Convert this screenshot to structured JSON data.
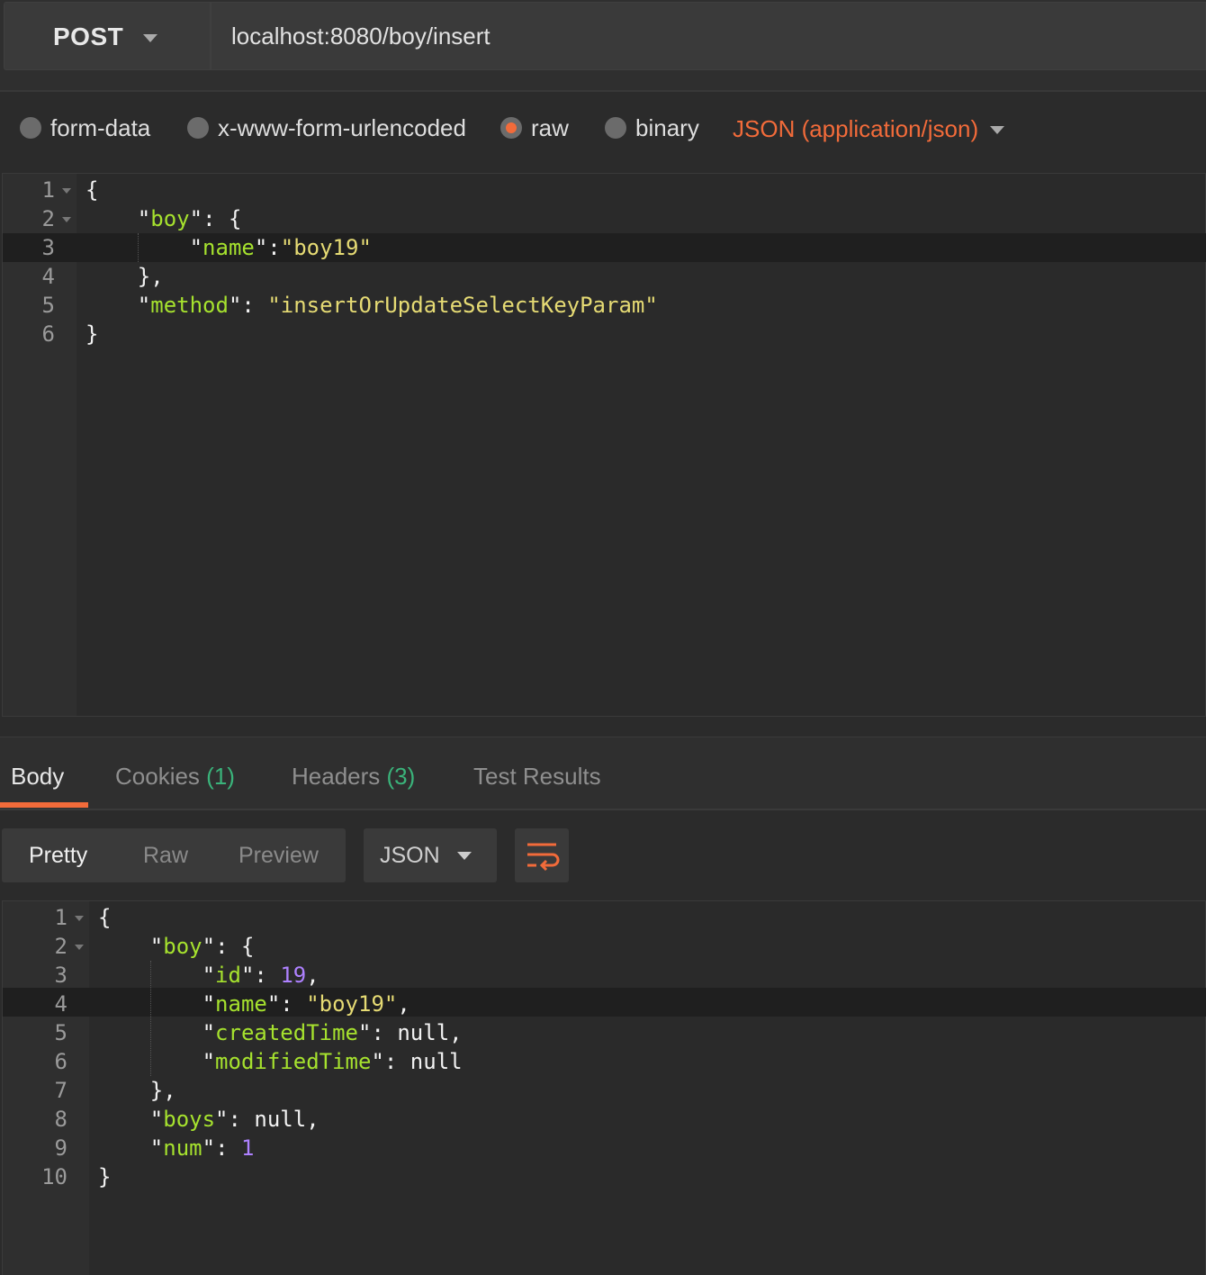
{
  "request": {
    "method": "POST",
    "url": "localhost:8080/boy/insert"
  },
  "body_modes": {
    "options": [
      "form-data",
      "x-www-form-urlencoded",
      "raw",
      "binary"
    ],
    "selected": "raw",
    "content_type": "JSON (application/json)"
  },
  "request_editor": {
    "line_numbers": [
      "1",
      "2",
      "3",
      "4",
      "5",
      "6"
    ],
    "lines": [
      "{",
      "    \"boy\": {",
      "        \"name\":\"boy19\"",
      "    },",
      "    \"method\": \"insertOrUpdateSelectKeyParam\"",
      "}"
    ]
  },
  "response_tabs": {
    "body": "Body",
    "cookies": "Cookies",
    "cookies_count": "(1)",
    "headers": "Headers",
    "headers_count": "(3)",
    "tests": "Test Results"
  },
  "view_modes": {
    "pretty": "Pretty",
    "raw": "Raw",
    "preview": "Preview",
    "format": "JSON"
  },
  "response_editor": {
    "line_numbers": [
      "1",
      "2",
      "3",
      "4",
      "5",
      "6",
      "7",
      "8",
      "9",
      "10"
    ],
    "lines": [
      "{",
      "    \"boy\": {",
      "        \"id\": 19,",
      "        \"name\": \"boy19\",",
      "        \"createdTime\": null,",
      "        \"modifiedTime\": null",
      "    },",
      "    \"boys\": null,",
      "    \"num\": 1",
      "}"
    ]
  },
  "colors": {
    "accent": "#f26b3a",
    "json_key": "#a6e22e",
    "json_string": "#e6db74",
    "json_number": "#ae81ff",
    "count_green": "#3ab37a"
  },
  "icons": {
    "method_dropdown": "chevron-down-icon",
    "content_type_dropdown": "chevron-down-icon",
    "format_dropdown": "chevron-down-icon",
    "wrap": "text-wrap-icon"
  }
}
